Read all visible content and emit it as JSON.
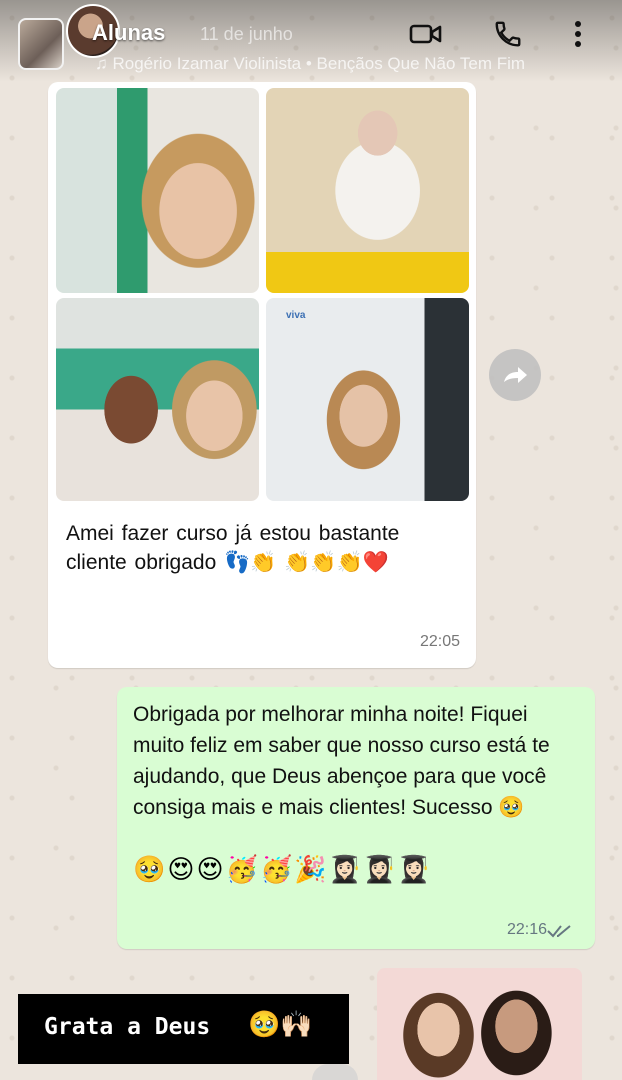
{
  "header": {
    "name": "Alunas",
    "date": "11 de junho",
    "music": "♫ Rogério Izamar Violinista • Bençãos Que Não Tem Fim"
  },
  "incoming": {
    "text": "Amei fazer curso já  estou bastante  cliente  obrigado 👣👏 👏👏👏❤️",
    "time": "22:05",
    "photo_label": "viva"
  },
  "outgoing": {
    "text": "Obrigada por melhorar minha noite! Fiquei muito feliz em saber que nosso curso está te ajudando, que Deus abençoe para que você consiga mais e mais clientes! Sucesso 🥹",
    "emojis": "🥹😍😍🥳🥳🎉👩🏻‍🎓👩🏻‍🎓👩🏻‍🎓",
    "time": "22:16"
  },
  "sticker": {
    "text": "Grata a Deus",
    "emoji": "🥹🙌🏻"
  },
  "colors": {
    "chat_bg": "#ece5dd",
    "incoming_bubble": "#ffffff",
    "outgoing_bubble": "#d9fdd3",
    "tick": "#667781"
  },
  "icons": [
    "video-call-icon",
    "phone-icon",
    "more-vert-icon",
    "forward-icon",
    "double-check-icon"
  ]
}
